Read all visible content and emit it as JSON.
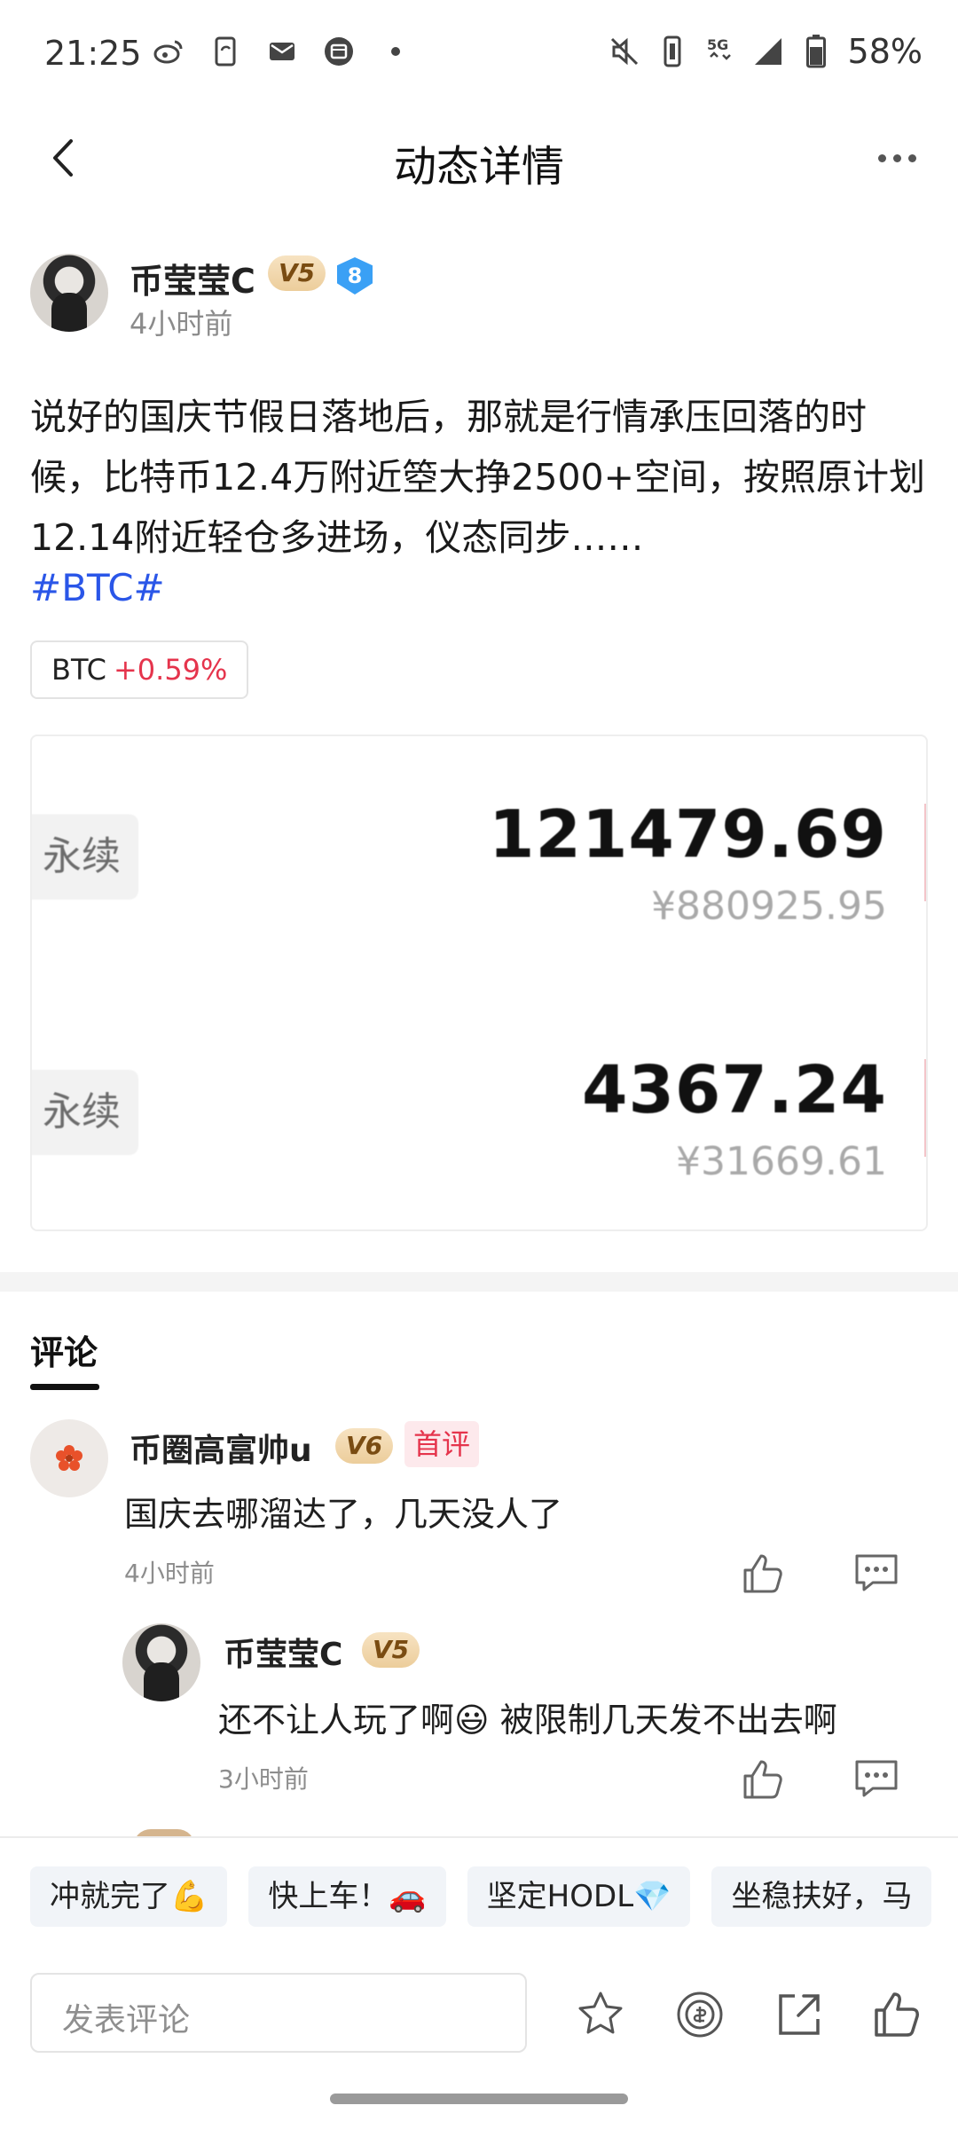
{
  "status_bar": {
    "time": "21:25",
    "left_icons": [
      "weibo-icon",
      "phone-sync-icon",
      "mail-icon",
      "calendar-icon",
      "dot-icon"
    ],
    "right_icons": [
      "mute-icon",
      "vibrate-icon",
      "5g-icon",
      "signal-icon",
      "battery-icon"
    ],
    "battery": "58%"
  },
  "header": {
    "title": "动态详情"
  },
  "post": {
    "author": "币莹莹C",
    "level": "V5",
    "rank_badge": "8",
    "time": "4小时前",
    "text": "说好的国庆节假日落地后，那就是行情承压回落的时候，比特币12.4万附近箜大挣2500+空间，按照原计划12.14附近轻仓多进场，仪态同步……",
    "hashtag": "#BTC#",
    "coin_tag": {
      "symbol": "BTC",
      "change": "+0.59%"
    },
    "image": {
      "rows": [
        {
          "tag": "永续",
          "price": "121479.69",
          "cny": "¥880925.95"
        },
        {
          "tag": "永续",
          "price": "4367.24",
          "cny": "¥31669.61"
        }
      ]
    }
  },
  "comments": {
    "tab_label": "评论",
    "items": [
      {
        "author": "币圈高富帅u",
        "level": "V6",
        "tag": "首评",
        "text": "国庆去哪溜达了，几天没人了",
        "time": "4小时前"
      },
      {
        "author": "币莹莹C",
        "level": "V5",
        "text": "还不让人玩了啊😃 被限制几天发不出去啊",
        "time": "3小时前"
      }
    ]
  },
  "quick_replies": [
    "冲就完了💪",
    "快上车！🚗",
    "坚定HODL💎",
    "坐稳扶好，马"
  ],
  "compose": {
    "placeholder": "发表评论"
  },
  "colors": {
    "accent_blue": "#2a56e8",
    "up_red": "#e5344c",
    "vip_gold": "#eccd9b"
  }
}
